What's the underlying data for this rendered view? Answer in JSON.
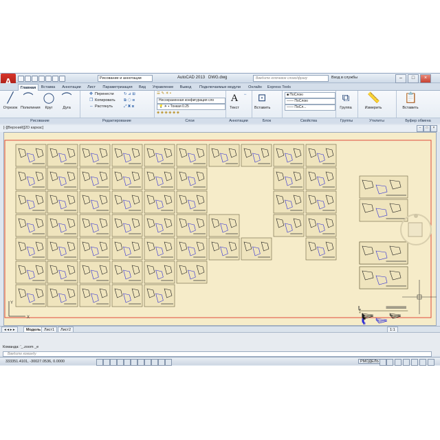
{
  "window": {
    "title": "AutoCAD 2013",
    "file": "DWG.dwg",
    "workspace": "Рисование и аннотации",
    "search_placeholder": "Введите ключевое слово/фразу",
    "signin": "Вход в службы"
  },
  "app_button": {
    "label": "A"
  },
  "tabs": [
    "Главная",
    "Вставка",
    "Аннотации",
    "Лист",
    "Параметризация",
    "Вид",
    "Управление",
    "Вывод",
    "Подключаемые модули",
    "Онлайн",
    "Express Tools"
  ],
  "ribbon": {
    "draw": {
      "title": "Рисование",
      "line": "Отрезок",
      "polyline": "Полилиния",
      "circle": "Круг",
      "arc": "Дуга"
    },
    "modify": {
      "title": "Редактирование",
      "move": "Перенести",
      "copy": "Копировать",
      "stretch": "Растянуть"
    },
    "layers": {
      "title": "Слои",
      "layer_state": "Несохраненная конфигурация сло",
      "current_layer": "Тонкая 0.25"
    },
    "annotation": {
      "title": "Аннотации",
      "text": "Текст"
    },
    "block": {
      "title": "Блок",
      "insert": "Вставить"
    },
    "properties": {
      "title": "Свойства",
      "color": "ПоСлою",
      "linetype": "ПоСлою",
      "lineweight": "ПоСл..."
    },
    "groups": {
      "title": "Группы",
      "group": "Группа"
    },
    "utilities": {
      "title": "Утилиты",
      "measure": "Измерить"
    },
    "clipboard": {
      "title": "Буфер обмена",
      "paste": "Вставить"
    }
  },
  "viewport": {
    "label": "[-][Верхний][2D каркас]"
  },
  "layout_tabs": [
    "Модель",
    "Лист1",
    "Лист2"
  ],
  "command": {
    "history": "Команда: '_.zoom _e",
    "placeholder": "Введите команду"
  },
  "status": {
    "coords": "333351.4101, -30027.0536, 0.0000",
    "model": "РМОДЕЛЬ",
    "scale": "1:1"
  }
}
